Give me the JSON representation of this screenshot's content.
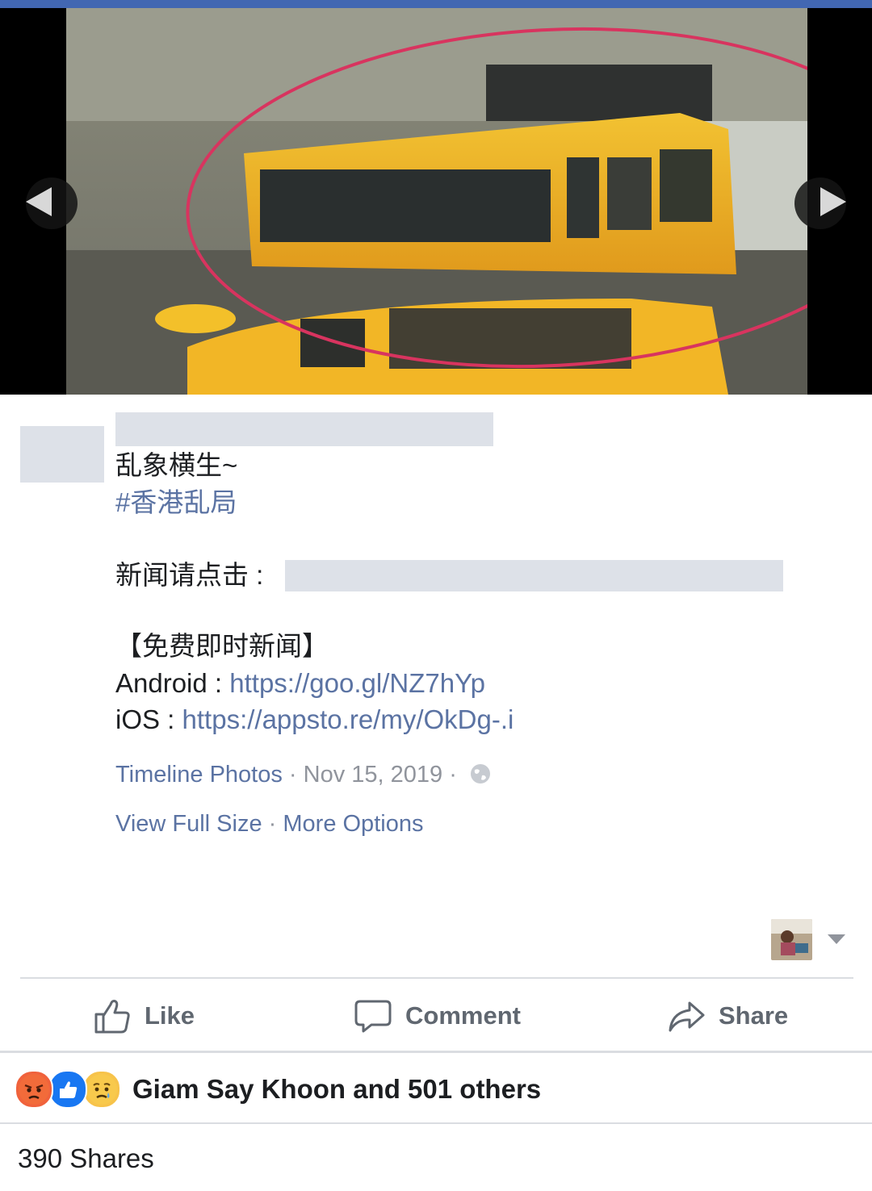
{
  "viewer": {
    "prev_icon": "triangle-left-icon",
    "next_icon": "triangle-right-icon"
  },
  "post": {
    "caption_line1": "乱象横生~",
    "hashtag": "#香港乱局",
    "news_prefix": "新闻请点击 :",
    "free_news": "【免费即时新闻】",
    "android_label": "Android : ",
    "android_url": "https://goo.gl/NZ7hYp",
    "ios_label": "iOS : ",
    "ios_url": "https://appsto.re/my/OkDg-.i"
  },
  "meta": {
    "album": "Timeline Photos",
    "sep": " · ",
    "date": "Nov 15, 2019",
    "privacy_icon": "globe-icon",
    "view_full_size": "View Full Size",
    "more_options": "More Options"
  },
  "actions": {
    "like": "Like",
    "comment": "Comment",
    "share": "Share"
  },
  "reactions": {
    "icons": [
      "angry-reaction-icon",
      "like-reaction-icon",
      "sad-reaction-icon"
    ],
    "text": "Giam Say Khoon and 501 others"
  },
  "shares": "390 Shares",
  "colors": {
    "brand": "#4267b2",
    "link": "#5b73a3",
    "placeholder": "#dde1e8"
  }
}
